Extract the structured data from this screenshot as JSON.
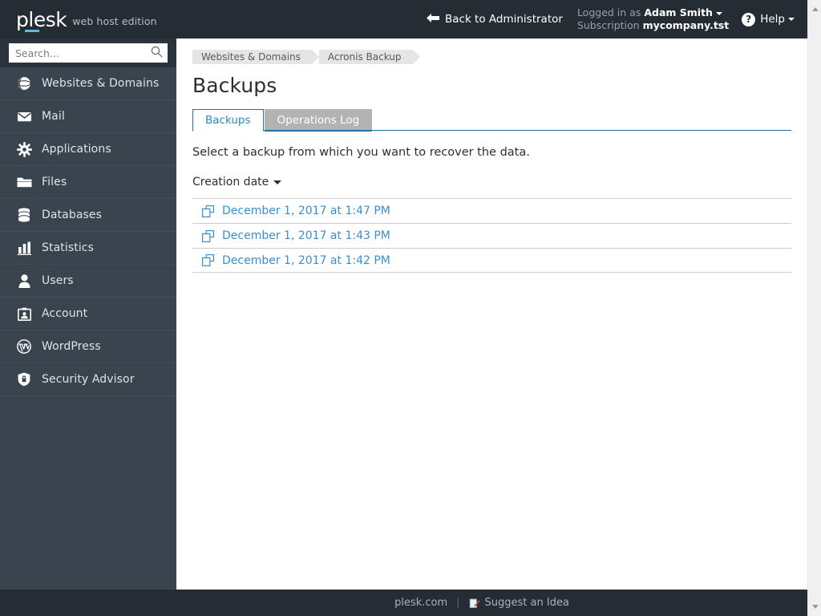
{
  "header": {
    "logo_text": "plesk",
    "logo_edition": "web host edition",
    "back_label": "Back to Administrator",
    "logged_in_label": "Logged in as",
    "user_name": "Adam Smith",
    "subscription_label": "Subscription",
    "subscription_value": "mycompany.tst",
    "help_label": "Help",
    "back_icon": "back-arrow-icon",
    "help_icon": "question-mark-icon"
  },
  "search": {
    "placeholder": "Search...",
    "value": "",
    "icon": "search-icon"
  },
  "sidebar": {
    "items": [
      {
        "label": "Websites & Domains",
        "icon": "globe-icon"
      },
      {
        "label": "Mail",
        "icon": "envelope-icon"
      },
      {
        "label": "Applications",
        "icon": "gear-icon"
      },
      {
        "label": "Files",
        "icon": "folder-icon"
      },
      {
        "label": "Databases",
        "icon": "database-icon"
      },
      {
        "label": "Statistics",
        "icon": "bar-chart-icon"
      },
      {
        "label": "Users",
        "icon": "user-icon"
      },
      {
        "label": "Account",
        "icon": "id-card-icon"
      },
      {
        "label": "WordPress",
        "icon": "wordpress-icon"
      },
      {
        "label": "Security Advisor",
        "icon": "shield-icon"
      }
    ]
  },
  "breadcrumb": [
    {
      "label": "Websites & Domains"
    },
    {
      "label": "Acronis Backup"
    }
  ],
  "main": {
    "page_title": "Backups",
    "tabs": [
      {
        "label": "Backups",
        "active": true
      },
      {
        "label": "Operations Log",
        "active": false
      }
    ],
    "intro_text": "Select a backup from which you want to recover the data.",
    "sort": {
      "label": "Creation date",
      "caret_icon": "chevron-down-icon"
    },
    "backups": [
      {
        "label": "December 1, 2017 at 1:47 PM",
        "icon": "stacked-windows-icon"
      },
      {
        "label": "December 1, 2017 at 1:43 PM",
        "icon": "stacked-windows-icon"
      },
      {
        "label": "December 1, 2017 at 1:42 PM",
        "icon": "stacked-windows-icon"
      }
    ]
  },
  "footer": {
    "site_link": "plesk.com",
    "separator": "|",
    "idea_link": "Suggest an Idea",
    "idea_icon": "pencil-note-icon"
  },
  "colors": {
    "header_bg": "#252c33",
    "sidebar_bg": "#39444f",
    "accent_cyan": "#53bde0",
    "link_blue": "#3b8fce",
    "tab_active_border": "#2273a5",
    "tab_active_text": "#2c89b8",
    "tab_inactive_bg": "#b3b3b3"
  }
}
